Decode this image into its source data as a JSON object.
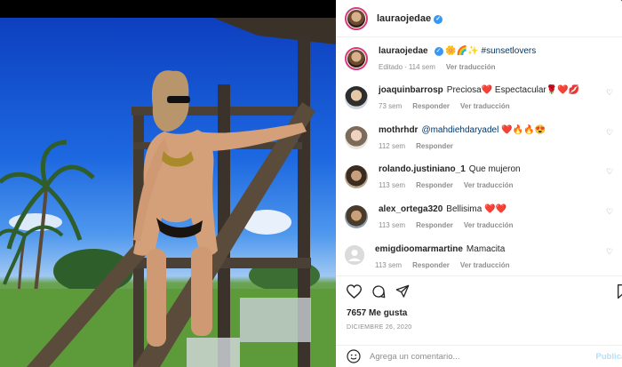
{
  "post": {
    "author": "lauraojedae",
    "caption_emojis": "🌼🌈✨",
    "caption_tag": "#sunsetlovers",
    "edited": "Editado",
    "age": "114 sem",
    "see_translation": "Ver traducción"
  },
  "comments": [
    {
      "user": "joaquinbarrosp",
      "text": "Preciosa❤️ Espectacular🌹❤️💋",
      "age": "73 sem",
      "reply": "Responder",
      "translate": "Ver traducción"
    },
    {
      "user": "mothrhdr",
      "text": "@mahdiehdaryadel ❤️🔥🔥😍",
      "age": "112 sem",
      "reply": "Responder",
      "translate": ""
    },
    {
      "user": "rolando.justiniano_1",
      "text": "Que mujeron",
      "age": "113 sem",
      "reply": "Responder",
      "translate": "Ver traducción"
    },
    {
      "user": "alex_ortega320",
      "text": "Bellisima ❤️❤️",
      "age": "113 sem",
      "reply": "Responder",
      "translate": "Ver traducción"
    },
    {
      "user": "emigdioomarmartine",
      "text": "Mamacita",
      "age": "113 sem",
      "reply": "Responder",
      "translate": "Ver traducción"
    }
  ],
  "likes": "7657 Me gusta",
  "date": "DICIEMBRE 26, 2020",
  "add_comment": {
    "placeholder": "Agrega un comentario...",
    "publish": "Publicar"
  },
  "icons": [
    "verified-icon",
    "heart-icon",
    "comment-icon",
    "share-icon",
    "bookmark-icon",
    "emoji-icon"
  ]
}
